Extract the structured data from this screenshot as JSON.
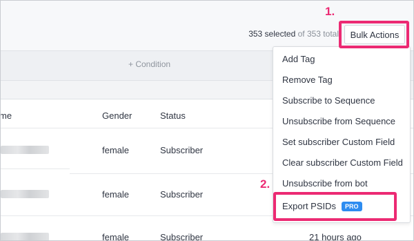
{
  "header": {
    "selected_count": "353 selected",
    "selected_of": "of 353 total",
    "bulk_actions_label": "Bulk Actions"
  },
  "annotations": {
    "step1": "1.",
    "step2": "2."
  },
  "condition_label": "+ Condition",
  "table": {
    "columns": [
      "me",
      "Gender",
      "Status"
    ],
    "rows": [
      {
        "gender": "female",
        "status": "Subscriber",
        "last": ""
      },
      {
        "gender": "female",
        "status": "Subscriber",
        "last": ""
      },
      {
        "gender": "female",
        "status": "Subscriber",
        "last": "21 hours ago"
      }
    ]
  },
  "bulk_menu": {
    "items": [
      "Add Tag",
      "Remove Tag",
      "Subscribe to Sequence",
      "Unsubscribe from Sequence",
      "Set subscriber Custom Field",
      "Clear subscriber Custom Field",
      "Unsubscribe from bot",
      "Export PSIDs"
    ],
    "pro_badge": "PRO"
  },
  "colors": {
    "highlight": "#ec2a73",
    "pro_badge": "#2d8cf0"
  }
}
